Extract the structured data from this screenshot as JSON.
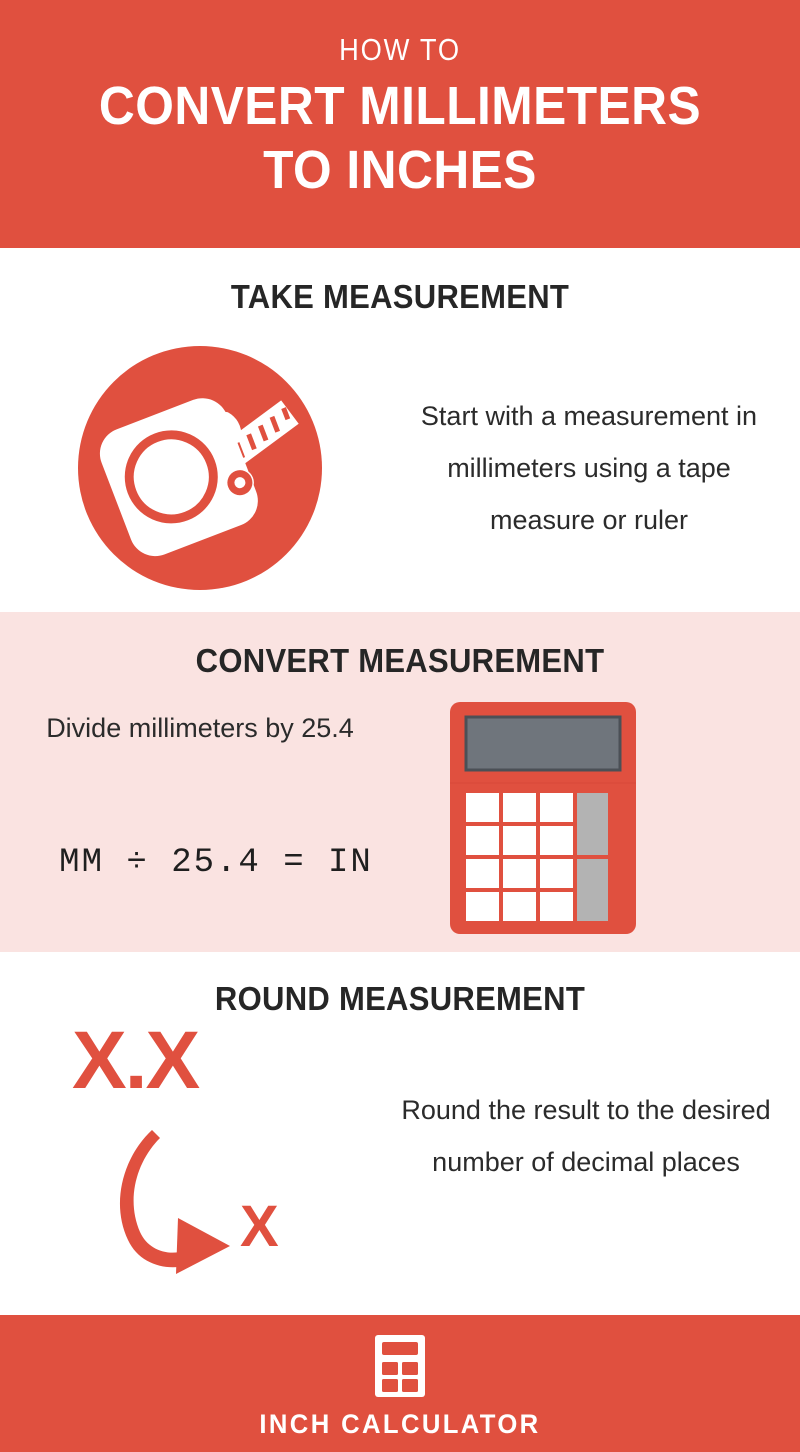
{
  "colors": {
    "brand_red": "#E0503F",
    "pink_band": "#FAE3E1",
    "heading_dark": "#262626",
    "body_dark": "#2b2b2b",
    "white": "#FFFFFF",
    "calculator_display_gray": "#6F757C",
    "calculator_display_border": "#4B5056",
    "calculator_func_key_gray": "#B3B3B3"
  },
  "header": {
    "kicker": "HOW TO",
    "title_line1": "CONVERT MILLIMETERS",
    "title_line2": "TO INCHES"
  },
  "sections": [
    {
      "id": "take-measurement",
      "heading": "TAKE MEASUREMENT",
      "body": "Start with a measurement in millimeters using a tape measure or ruler",
      "icon": "tape-measure-icon",
      "background": "#FFFFFF"
    },
    {
      "id": "convert-measurement",
      "heading": "CONVERT MEASUREMENT",
      "body": "Divide millimeters by 25.4",
      "formula": "MM ÷ 25.4 = IN",
      "icon": "calculator-icon",
      "background": "#FAE3E1"
    },
    {
      "id": "round-measurement",
      "heading": "ROUND MEASUREMENT",
      "body": "Round the result to the desired number of decimal places",
      "graphic": {
        "from_value": "X.X",
        "to_value": "X",
        "arrow": "curved-arrow-icon"
      },
      "background": "#FFFFFF"
    }
  ],
  "footer": {
    "logo_icon": "calculator-logo-icon",
    "brand": "INCH CALCULATOR"
  },
  "conversion": {
    "divisor": "25.4",
    "from_unit": "MM",
    "to_unit": "IN"
  }
}
